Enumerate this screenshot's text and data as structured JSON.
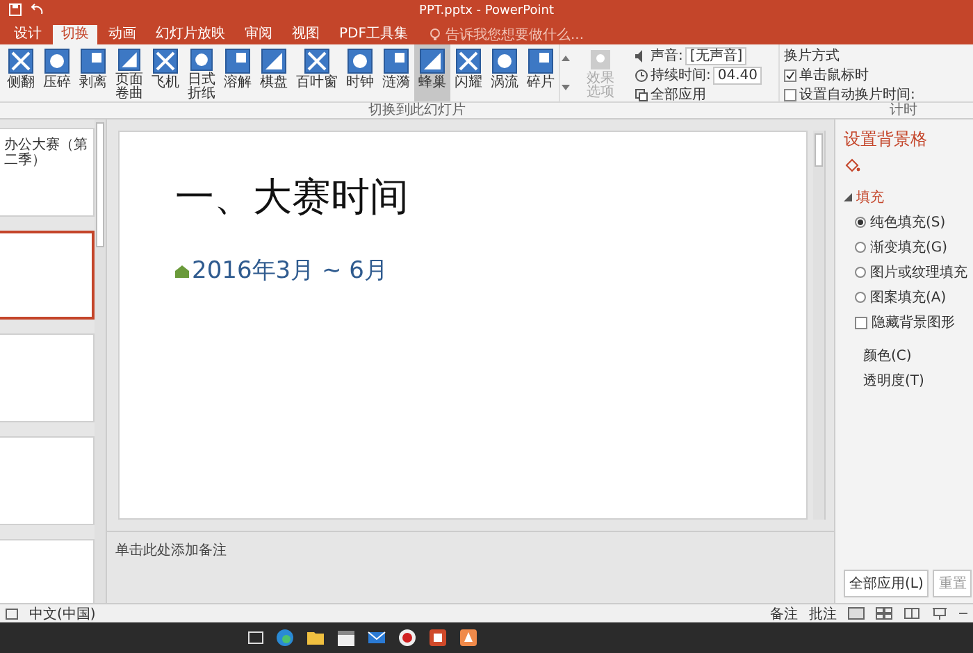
{
  "title_bar": {
    "title": "PPT.pptx - PowerPoint"
  },
  "ribbon_tabs": [
    {
      "label": "设计",
      "selected": false
    },
    {
      "label": "切换",
      "selected": true
    },
    {
      "label": "动画",
      "selected": false
    },
    {
      "label": "幻灯片放映",
      "selected": false
    },
    {
      "label": "审阅",
      "selected": false
    },
    {
      "label": "视图",
      "selected": false
    },
    {
      "label": "PDF工具集",
      "selected": false
    }
  ],
  "tell_me": {
    "placeholder": "告诉我您想要做什么..."
  },
  "transitions": [
    {
      "label": "侧翻",
      "selected": false
    },
    {
      "label": "压碎",
      "selected": false
    },
    {
      "label": "剥离",
      "selected": false
    },
    {
      "label": "页面卷曲",
      "selected": false
    },
    {
      "label": "飞机",
      "selected": false
    },
    {
      "label": "日式折纸",
      "selected": false
    },
    {
      "label": "溶解",
      "selected": false
    },
    {
      "label": "棋盘",
      "selected": false
    },
    {
      "label": "百叶窗",
      "selected": false
    },
    {
      "label": "时钟",
      "selected": false
    },
    {
      "label": "涟漪",
      "selected": false
    },
    {
      "label": "蜂巢",
      "selected": true
    },
    {
      "label": "闪耀",
      "selected": false
    },
    {
      "label": "涡流",
      "selected": false
    },
    {
      "label": "碎片",
      "selected": false
    }
  ],
  "effect_options": {
    "label": "效果选项",
    "disabled": true
  },
  "sound": {
    "label": "声音:",
    "value": "[无声音]"
  },
  "duration": {
    "label": "持续时间:",
    "value": "04.40"
  },
  "apply_all": "全部应用",
  "advance": {
    "title": "换片方式",
    "options": [
      {
        "label": "单击鼠标时",
        "checked": true
      },
      {
        "label": "设置自动换片时间:",
        "checked": false
      }
    ]
  },
  "group_labels": [
    "切换到此幻灯片",
    "计时"
  ],
  "thumbnails": [
    {
      "text": "办公大赛（第二季）",
      "selected": false
    },
    {
      "selected": true
    },
    {
      "selected": false
    },
    {
      "selected": false
    },
    {
      "selected": false
    }
  ],
  "slide": {
    "title": "一、大赛时间",
    "bullet": "2016年3月 ~ 6月"
  },
  "notes": {
    "placeholder": "单击此处添加备注"
  },
  "format_pane": {
    "title": "设置背景格",
    "section": {
      "label": "填充",
      "expanded": true
    },
    "options": [
      {
        "kind": "radio",
        "label": "纯色填充(S)",
        "selected": true
      },
      {
        "kind": "radio",
        "label": "渐变填充(G)",
        "selected": false
      },
      {
        "kind": "radio",
        "label": "图片或纹理填充",
        "selected": false
      },
      {
        "kind": "radio",
        "label": "图案填充(A)",
        "selected": false
      },
      {
        "kind": "checkbox",
        "label": "隐藏背景图形",
        "checked": false
      }
    ],
    "color_label": "颜色(C)",
    "transparency_label": "透明度(T)",
    "buttons": [
      "全部应用(L)",
      "重置"
    ]
  },
  "status_bar": {
    "language": "中文(中国)",
    "notes": "备注",
    "comments": "批注"
  }
}
